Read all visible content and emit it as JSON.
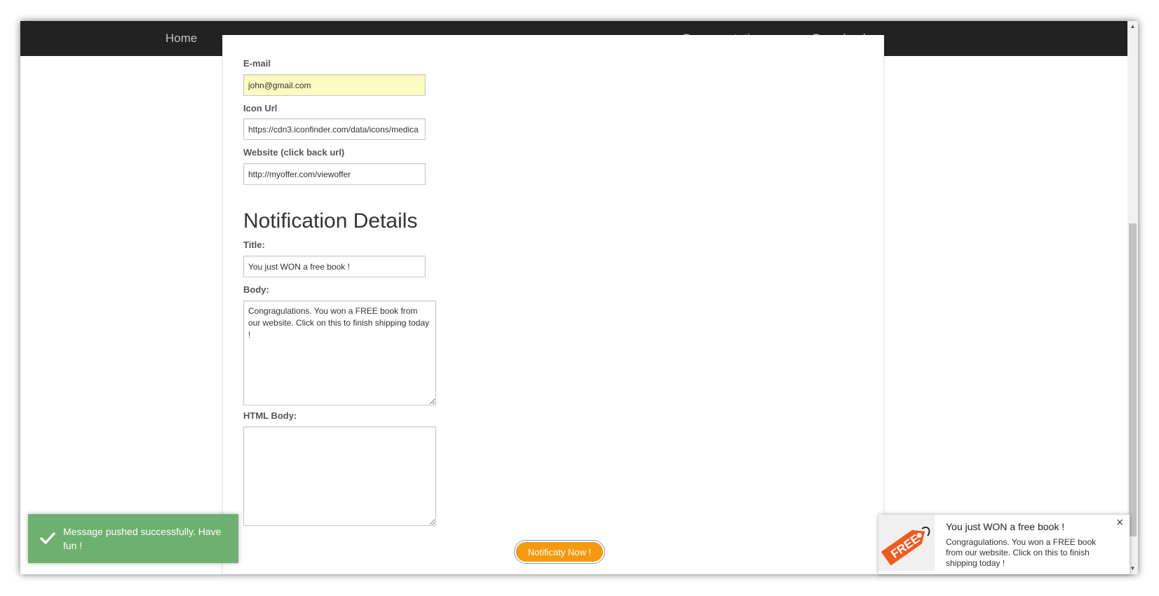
{
  "nav": {
    "home": "Home",
    "documentation": "Documentation",
    "download": "Download"
  },
  "form": {
    "email_label": "E-mail",
    "email_value": "john@gmail.com",
    "icon_url_label": "Icon Url",
    "icon_url_value": "https://cdn3.iconfinder.com/data/icons/medica",
    "website_label": "Website (click back url)",
    "website_value": "http://myoffer.com/viewoffer",
    "section_heading": "Notification Details",
    "title_label": "Title:",
    "title_value": "You just WON a free book !",
    "body_label": "Body:",
    "body_value": "Congragulations. You won a FREE book from our website. Click on this to finish shipping today !",
    "html_body_label": "HTML Body:",
    "html_body_value": "",
    "submit_label": "Notificaty Now !"
  },
  "toast": {
    "message": "Message pushed successfully. Have fun !",
    "icon": "check-icon"
  },
  "notification": {
    "title": "You just WON a free book !",
    "body": "Congragulations. You won a FREE book from our website. Click on this to finish shipping today !",
    "badge_text": "FREE",
    "close": "×",
    "icon": "free-tag-icon"
  },
  "colors": {
    "navbar": "#222222",
    "button": "#f7990f",
    "toast": "#6db070",
    "badge": "#f05a1e"
  }
}
